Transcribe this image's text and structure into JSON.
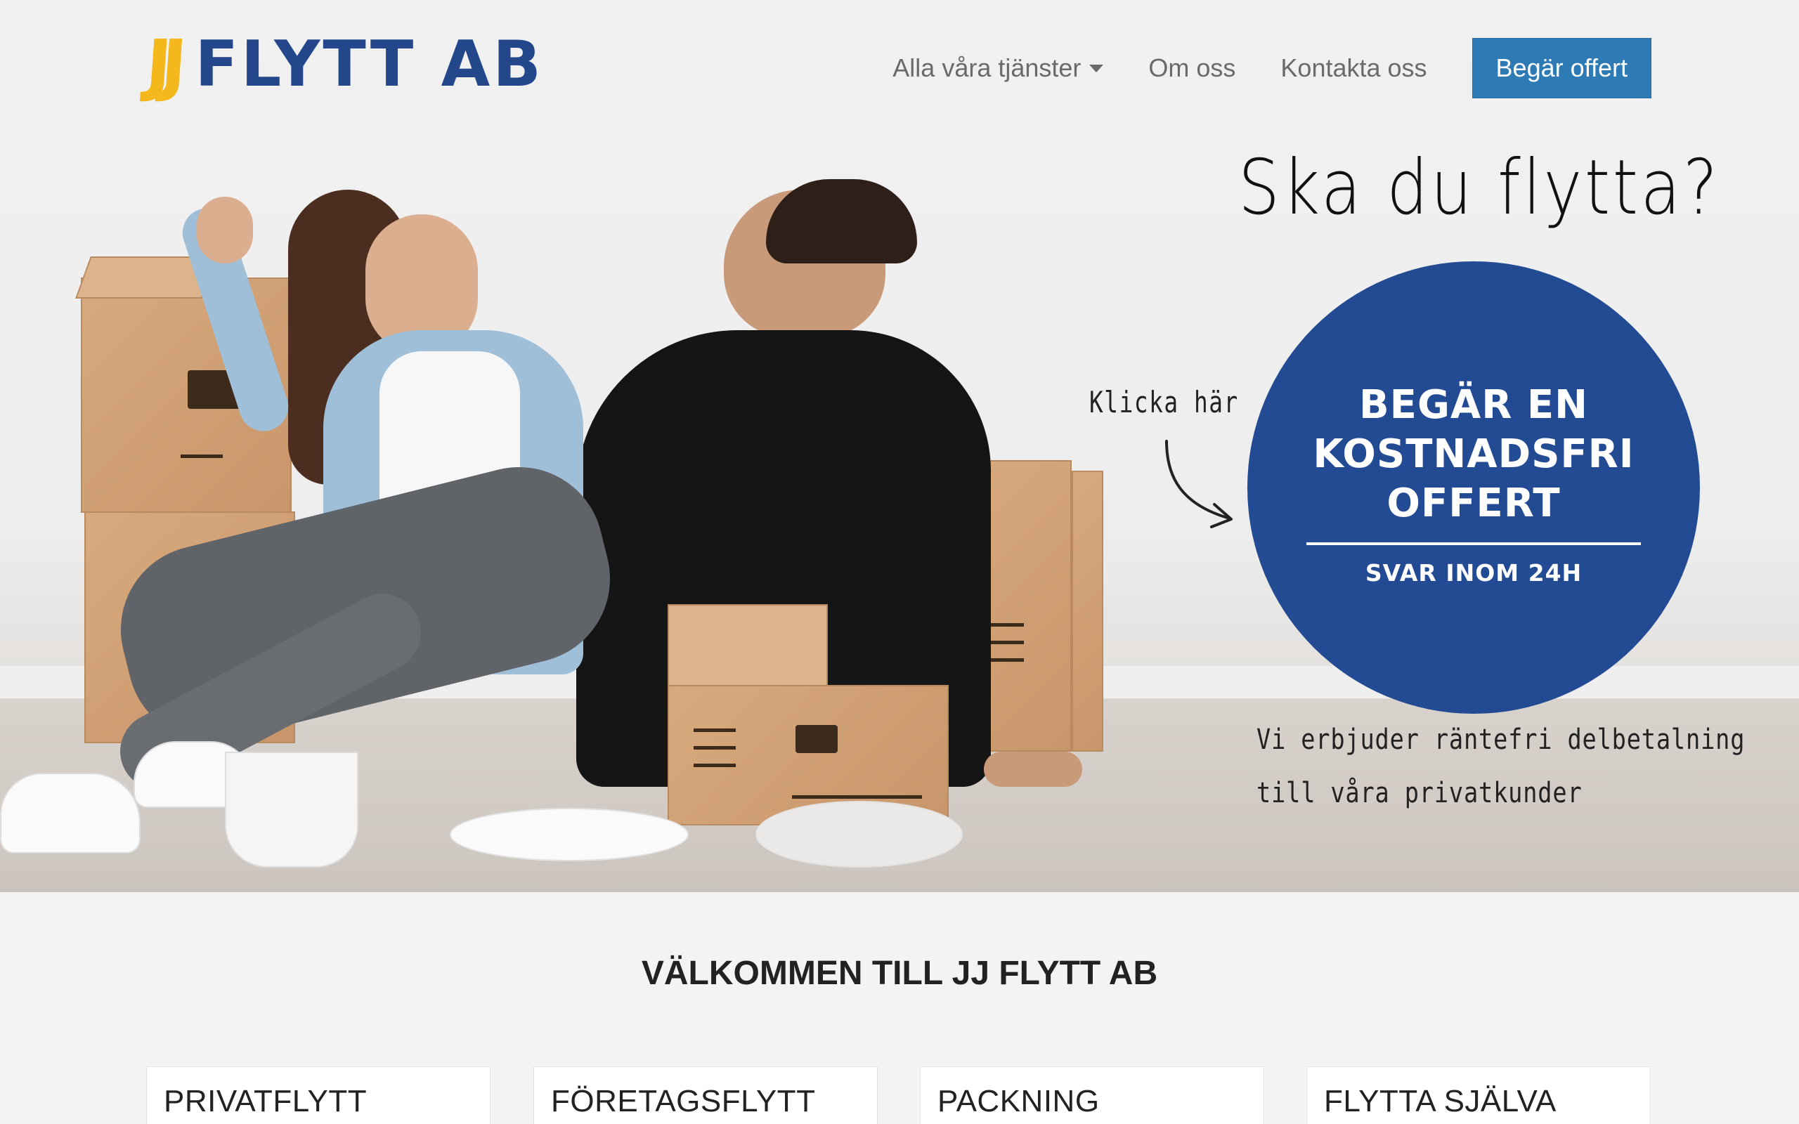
{
  "brand": {
    "logo_mark": "JJ",
    "logo_text": "FLYTT AB"
  },
  "nav": {
    "services_label": "Alla våra tjänster",
    "about_label": "Om oss",
    "contact_label": "Kontakta oss",
    "cta_label": "Begär offert"
  },
  "hero": {
    "headline": "Ska du flytta?",
    "click_hint": "Klicka här",
    "circle_line1": "BEGÄR EN",
    "circle_line2": "KOSTNADSFRI",
    "circle_line3": "OFFERT",
    "circle_sub": "SVAR INOM 24H",
    "note_line1": "Vi erbjuder räntefri delbetalning",
    "note_line2": "till våra privatkunder"
  },
  "welcome": {
    "title": "VÄLKOMMEN TILL JJ FLYTT AB"
  },
  "services": [
    {
      "title": "PRIVATFLYTT"
    },
    {
      "title": "FÖRETAGSFLYTT"
    },
    {
      "title": "PACKNING"
    },
    {
      "title": "FLYTTA SJÄLVA"
    }
  ],
  "colors": {
    "brand_blue": "#24478b",
    "brand_yellow": "#f4b81c",
    "cta_blue": "#2d7ab4",
    "circle_blue": "#234b94"
  }
}
